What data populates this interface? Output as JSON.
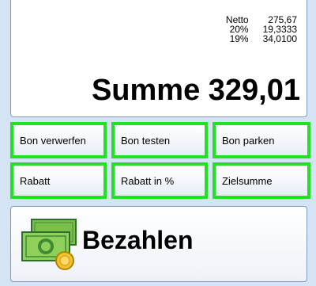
{
  "summary": {
    "taxes": [
      {
        "label": "Netto",
        "value": "275,67"
      },
      {
        "label": "20%",
        "value": "19,3333"
      },
      {
        "label": "19%",
        "value": "34,0100"
      }
    ],
    "total_label": "Summe 329,01"
  },
  "buttons": {
    "row1": [
      "Bon verwerfen",
      "Bon testen",
      "Bon parken"
    ],
    "row2": [
      "Rabatt",
      "Rabatt in %",
      "Zielsumme"
    ]
  },
  "pay": {
    "label": "Bezahlen",
    "icon": "money-icon"
  },
  "colors": {
    "highlight": "#22e022",
    "background": "#d4e4f4"
  }
}
